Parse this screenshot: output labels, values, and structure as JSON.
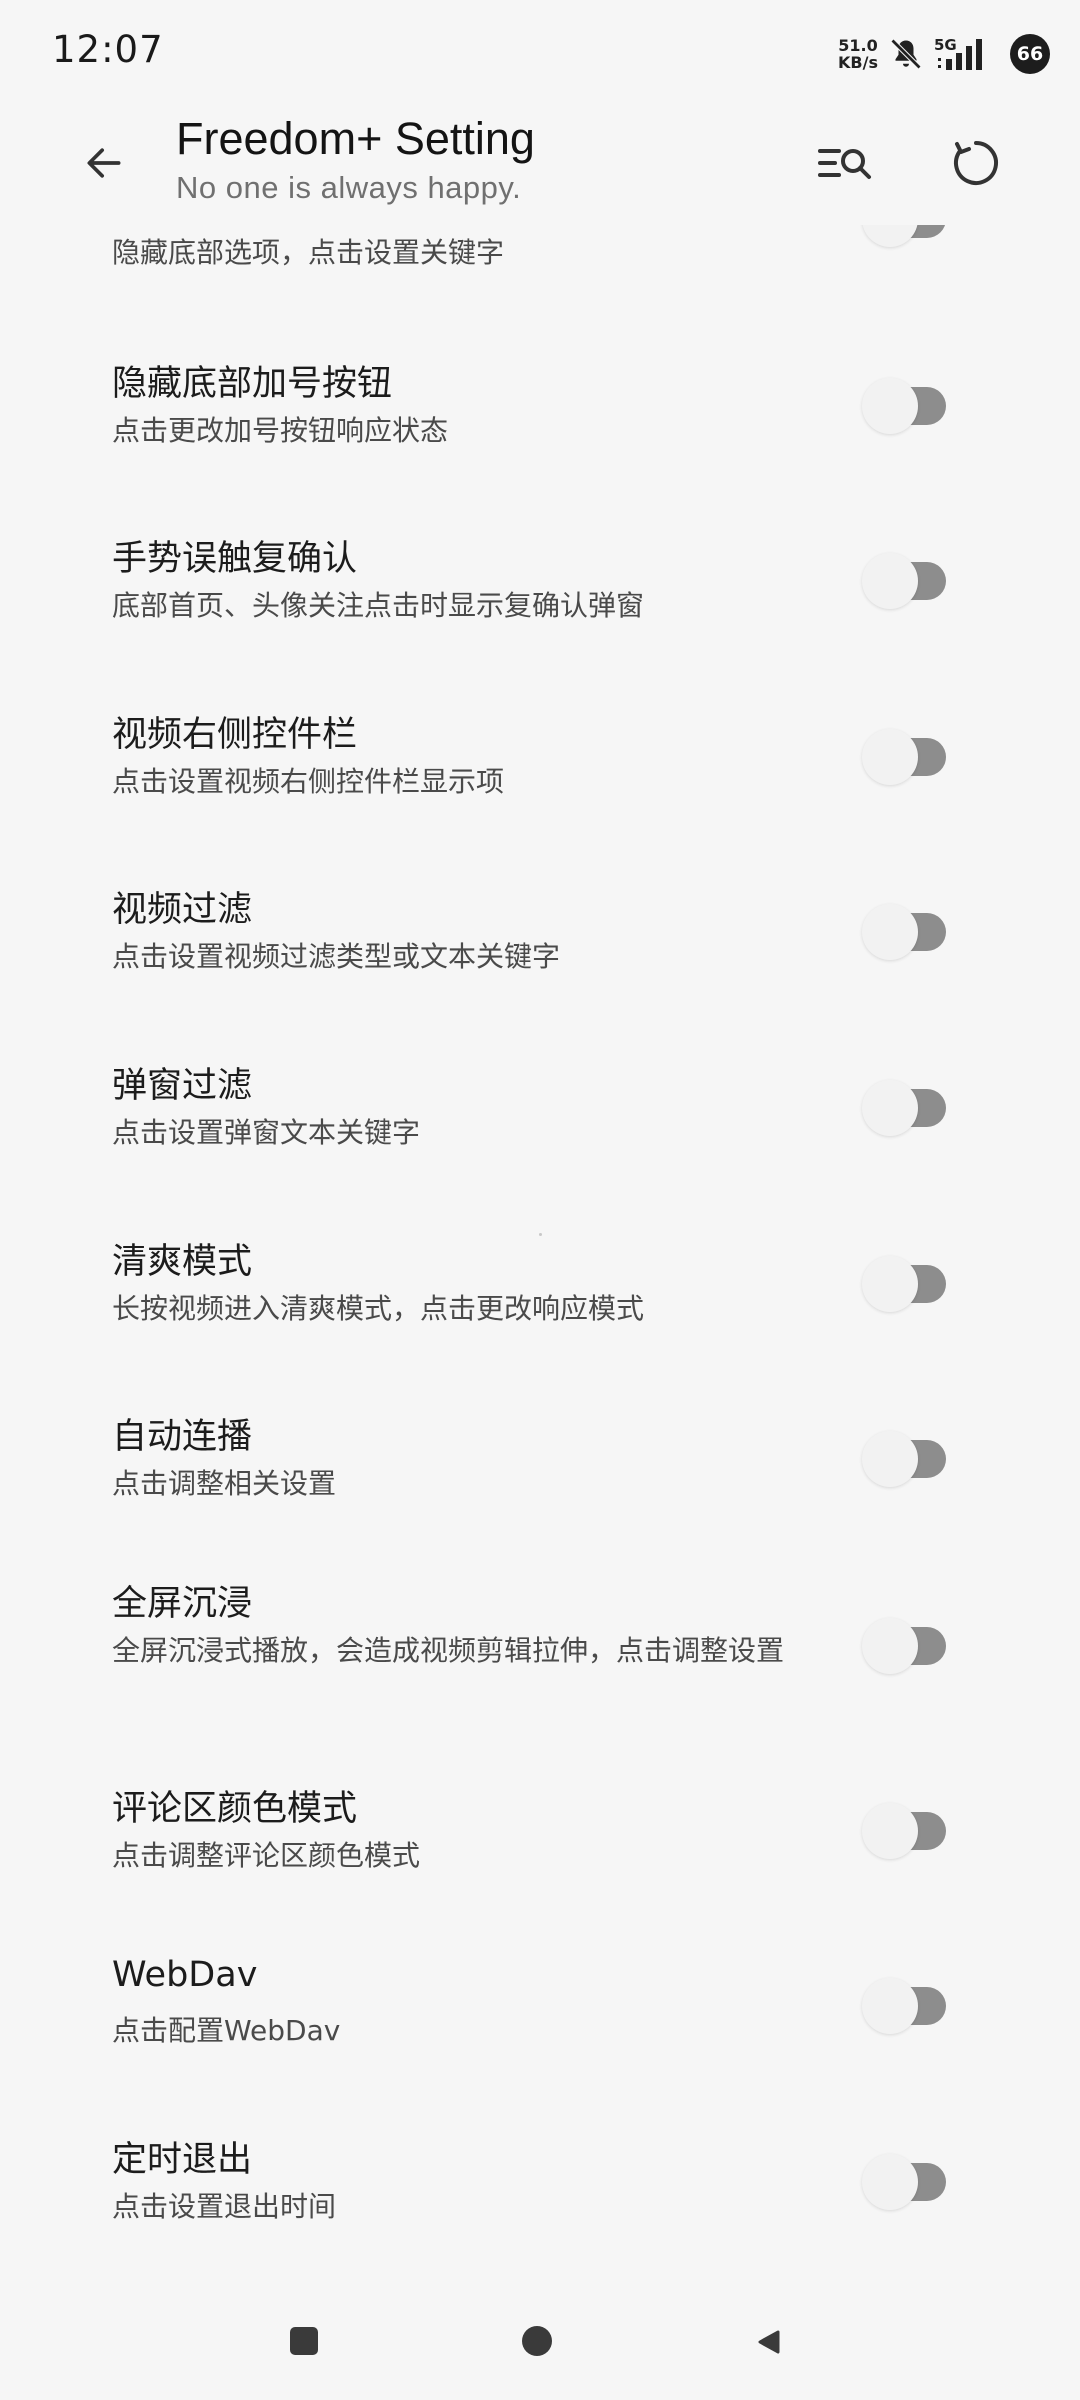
{
  "status_bar": {
    "time": "12:07",
    "net_speed_value": "51.0",
    "net_speed_unit": "KB/s",
    "network_type": "5G",
    "battery": "66",
    "icons": [
      "mute-bell-icon",
      "signal-icon",
      "battery-icon"
    ]
  },
  "app_bar": {
    "title": "Freedom+ Setting",
    "subtitle": "No one is always happy.",
    "icons": [
      "back-arrow-icon",
      "list-search-icon",
      "refresh-icon"
    ]
  },
  "settings": {
    "partial_desc": "隐藏底部选项，点击设置关键字",
    "items": [
      {
        "title": "隐藏底部加号按钮",
        "desc": "点击更改加号按钮响应状态",
        "enabled": false
      },
      {
        "title": "手势误触复确认",
        "desc": "底部首页、头像关注点击时显示复确认弹窗",
        "enabled": false
      },
      {
        "title": "视频右侧控件栏",
        "desc": "点击设置视频右侧控件栏显示项",
        "enabled": false
      },
      {
        "title": "视频过滤",
        "desc": "点击设置视频过滤类型或文本关键字",
        "enabled": false
      },
      {
        "title": "弹窗过滤",
        "desc": "点击设置弹窗文本关键字",
        "enabled": false
      },
      {
        "title": "清爽模式",
        "desc": "长按视频进入清爽模式，点击更改响应模式",
        "enabled": false
      },
      {
        "title": "自动连播",
        "desc": "点击调整相关设置",
        "enabled": false
      },
      {
        "title": "全屏沉浸",
        "desc": "全屏沉浸式播放，会造成视频剪辑拉伸，点击调整设置",
        "enabled": false
      },
      {
        "title": "评论区颜色模式",
        "desc": "点击调整评论区颜色模式",
        "enabled": false
      },
      {
        "title": "WebDav",
        "desc": "点击配置WebDav",
        "enabled": false
      },
      {
        "title": "定时退出",
        "desc": "点击设置退出时间",
        "enabled": false
      }
    ]
  },
  "nav_bar": {
    "icons": [
      "recents-square-icon",
      "home-circle-icon",
      "back-triangle-icon"
    ]
  },
  "colors": {
    "background": "#f6f6f6",
    "toggle_track": "#8d8d8d",
    "toggle_thumb": "#f2f2f2",
    "text_primary": "#1c1c1c",
    "text_secondary": "#4a4a4a"
  }
}
